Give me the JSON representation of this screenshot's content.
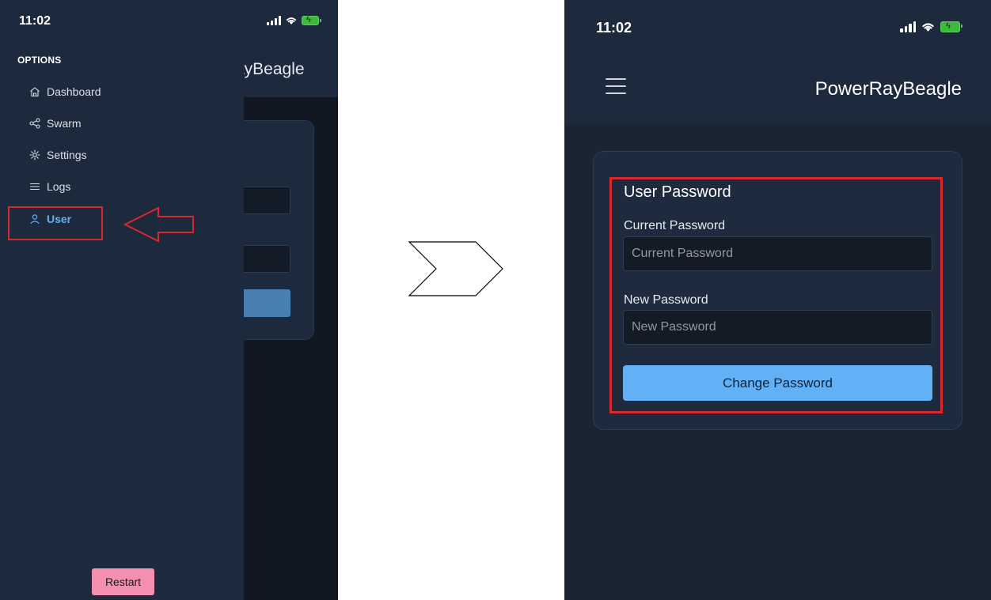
{
  "left_phone": {
    "status_bar": {
      "time": "11:02"
    },
    "app_bar": {
      "title_partial": "ayBeagle"
    },
    "drawer": {
      "heading": "OPTIONS",
      "items": [
        {
          "label": "Dashboard",
          "icon": "home-icon"
        },
        {
          "label": "Swarm",
          "icon": "share-nodes-icon"
        },
        {
          "label": "Settings",
          "icon": "gear-icon"
        },
        {
          "label": "Logs",
          "icon": "list-icon"
        },
        {
          "label": "User",
          "icon": "user-icon",
          "active": true
        }
      ],
      "restart_label": "Restart"
    }
  },
  "right_phone": {
    "status_bar": {
      "time": "11:02"
    },
    "app_bar": {
      "title": "PowerRayBeagle"
    },
    "form": {
      "title": "User Password",
      "current_password": {
        "label": "Current Password",
        "placeholder": "Current Password",
        "value": ""
      },
      "new_password": {
        "label": "New Password",
        "placeholder": "New Password",
        "value": ""
      },
      "submit_label": "Change Password"
    }
  },
  "colors": {
    "drawer_bg": "#1d2a3d",
    "active_nav": "#62b0f5",
    "restart_button": "#f48fb1",
    "primary_button": "#62b0f5",
    "annotation_red": "#d9282b",
    "battery_green": "#3dba3d"
  }
}
